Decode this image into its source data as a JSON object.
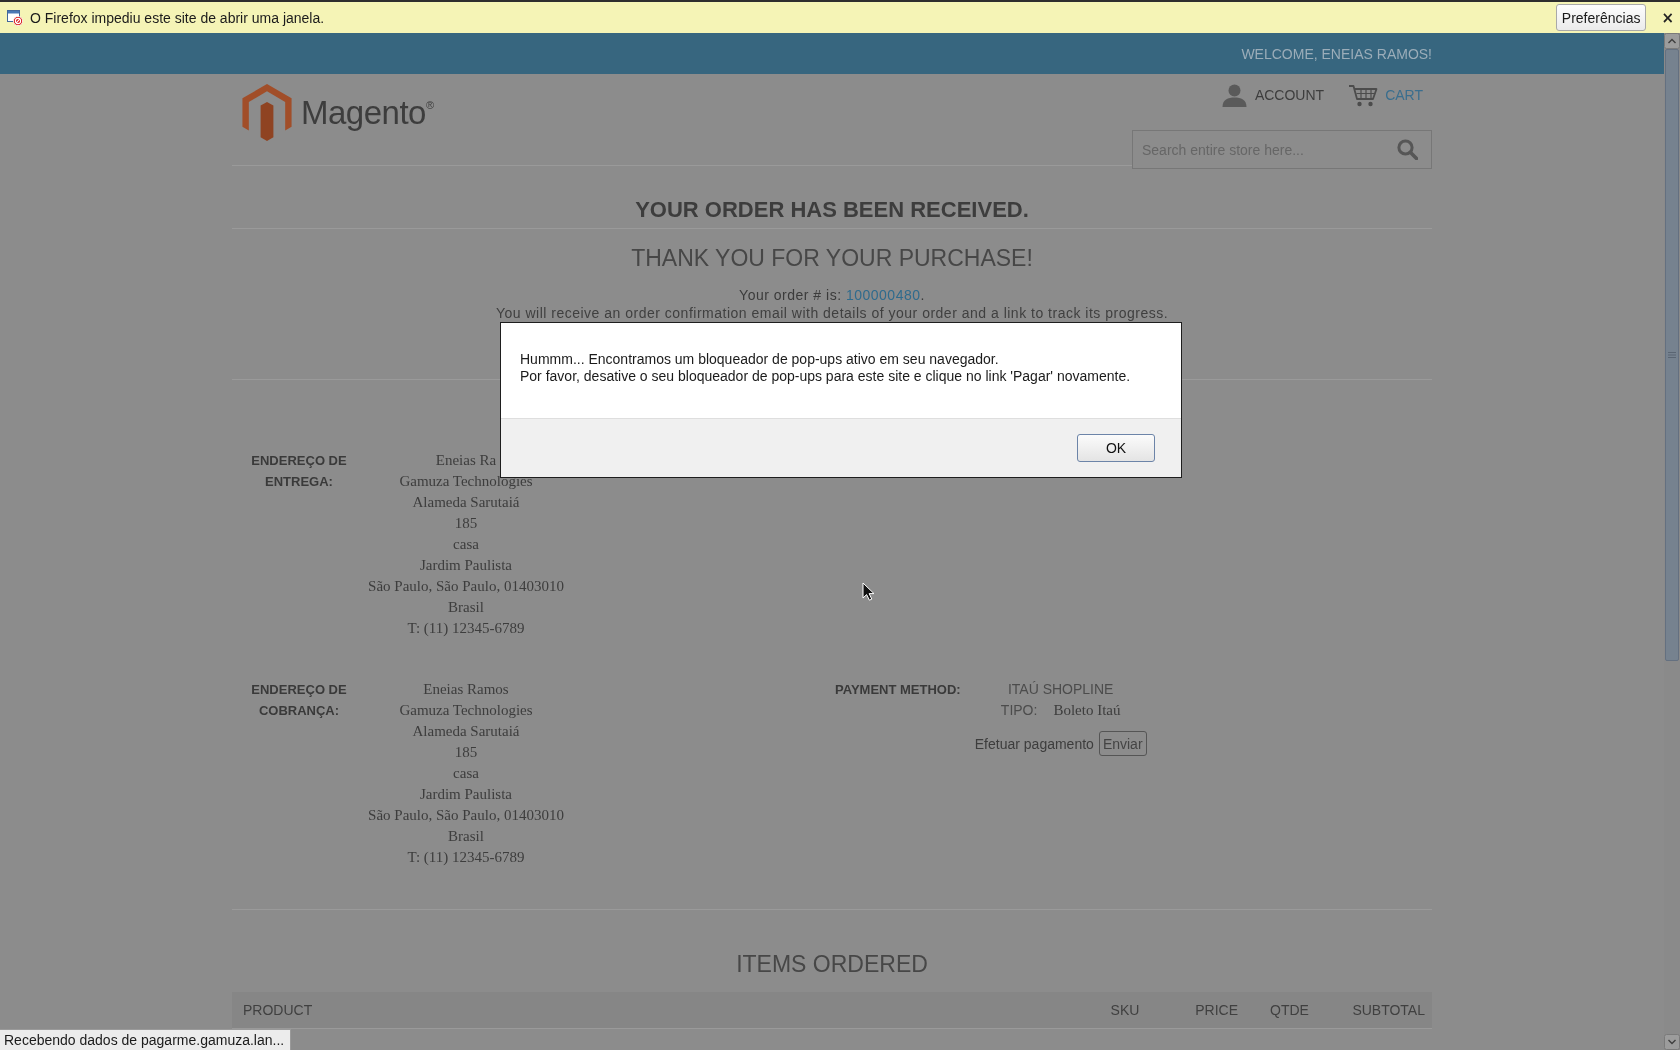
{
  "popup_notification": {
    "message": "O Firefox impediu este site de abrir uma janela.",
    "button": "Preferências",
    "close": "×"
  },
  "header": {
    "welcome": "WELCOME, ENEIAS RAMOS!",
    "logo_text": "Magento$^{®}$",
    "account": "ACCOUNT",
    "cart": "CART",
    "search": {
      "placeholder": "Search entire store here..."
    }
  },
  "confirmation": {
    "title": "YOUR ORDER HAS BEEN RECEIVED.",
    "subtitle": "THANK YOU FOR YOUR PURCHASE!",
    "order_label": "Your order # is:",
    "order_number": "100000480",
    "order_end": ".",
    "note": "You will receive an order confirmation email with details of your order and a link to track its progress."
  },
  "addresses": [
    {
      "label": "ENDEREÇO DE ENTREGA:",
      "lines": [
        "Eneias Ra",
        "Gamuza Technologies",
        "Alameda Sarutaiá",
        "185",
        "casa",
        "Jardim Paulista",
        "São Paulo, São Paulo, 01403010",
        "Brasil",
        "T: (11) 12345-6789"
      ]
    },
    {
      "label": "ENDEREÇO DE COBRANÇA:",
      "lines": [
        "Eneias Ramos",
        "Gamuza Technologies",
        "Alameda Sarutaiá",
        "185",
        "casa",
        "Jardim Paulista",
        "São Paulo, São Paulo, 01403010",
        "Brasil",
        "T: (11) 12345-6789"
      ]
    }
  ],
  "payment": {
    "label": "PAYMENT METHOD:",
    "method": "ITAÚ SHOPLINE",
    "type_label": "TIPO:",
    "type_value": "Boleto Itaú",
    "action_label": "Efetuar pagamento",
    "action_button": "Enviar"
  },
  "items_ordered": {
    "title": "ITEMS ORDERED",
    "columns": [
      "PRODUCT",
      "SKU",
      "PRICE",
      "QTDE",
      "SUBTOTAL"
    ]
  },
  "status_bar": {
    "text": "Recebendo dados de pagarme.gamuza.lan..."
  },
  "dialog": {
    "lines": [
      "Hummm... Encontramos um bloqueador de pop-ups ativo em seu navegador.",
      "Por favor, desative o seu bloqueador de pop-ups para este site e clique no link 'Pagar' novamente."
    ],
    "button": "OK"
  }
}
